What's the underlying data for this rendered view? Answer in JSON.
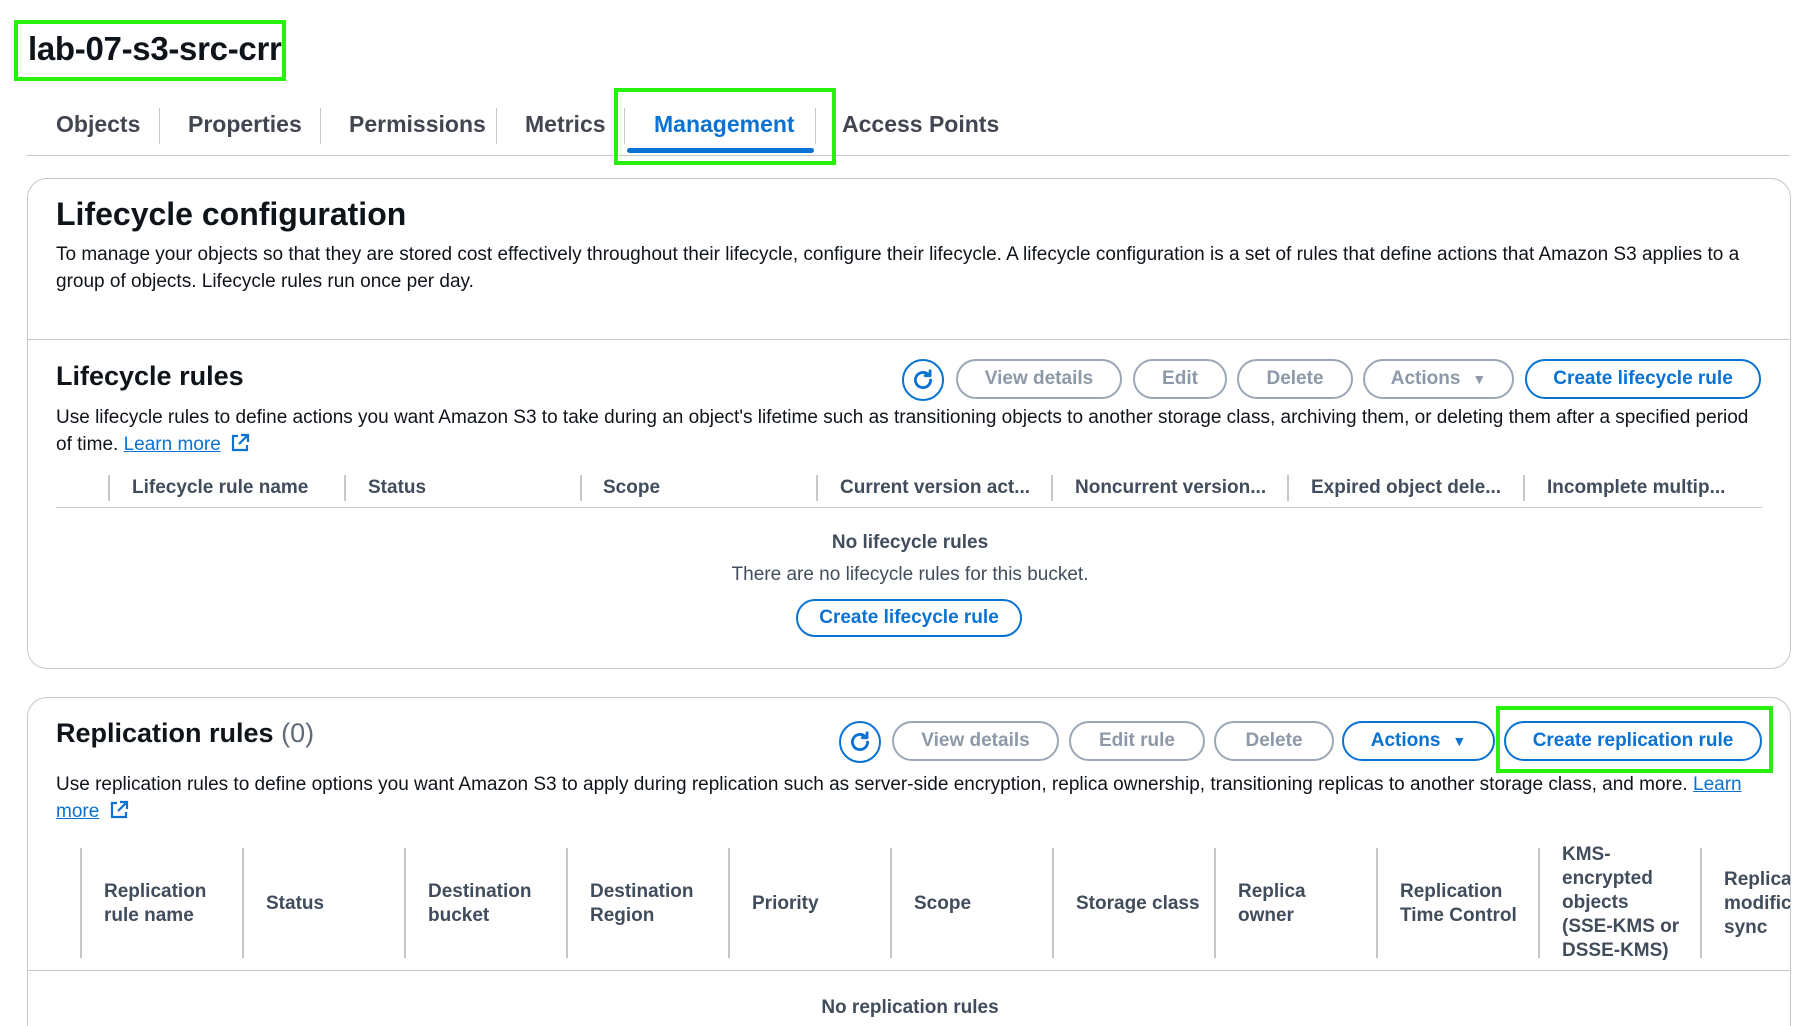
{
  "bucket": {
    "name": "lab-07-s3-src-crr"
  },
  "tabs": [
    {
      "label": "Objects"
    },
    {
      "label": "Properties"
    },
    {
      "label": "Permissions"
    },
    {
      "label": "Metrics"
    },
    {
      "label": "Management",
      "active": true
    },
    {
      "label": "Access Points"
    }
  ],
  "lifecycle": {
    "title": "Lifecycle configuration",
    "description": "To manage your objects so that they are stored cost effectively throughout their lifecycle, configure their lifecycle. A lifecycle configuration is a set of rules that define actions that Amazon S3 applies to a group of objects. Lifecycle rules run once per day.",
    "rules": {
      "title": "Lifecycle rules",
      "description": "Use lifecycle rules to define actions you want Amazon S3 to take during an object's lifetime such as transitioning objects to another storage class, archiving them, or deleting them after a specified period of time.",
      "learn_more": "Learn more",
      "buttons": {
        "view_details": "View details",
        "edit": "Edit",
        "delete": "Delete",
        "actions": "Actions",
        "create": "Create lifecycle rule"
      },
      "columns": [
        "Lifecycle rule name",
        "Status",
        "Scope",
        "Current version act...",
        "Noncurrent version...",
        "Expired object dele...",
        "Incomplete multip..."
      ],
      "empty_title": "No lifecycle rules",
      "empty_text": "There are no lifecycle rules for this bucket.",
      "empty_button": "Create lifecycle rule"
    }
  },
  "replication": {
    "title": "Replication rules",
    "count": "(0)",
    "description": "Use replication rules to define options you want Amazon S3 to apply during replication such as server-side encryption, replica ownership, transitioning replicas to another storage class, and more.",
    "learn_more": "Learn more",
    "buttons": {
      "view_details": "View details",
      "edit_rule": "Edit rule",
      "delete": "Delete",
      "actions": "Actions",
      "create": "Create replication rule"
    },
    "columns": [
      "Replication rule name",
      "Status",
      "Destination bucket",
      "Destination Region",
      "Priority",
      "Scope",
      "Storage class",
      "Replica owner",
      "Replication Time Control",
      "KMS-encrypted objects (SSE-KMS or DSSE-KMS)",
      "Replica modific sync"
    ],
    "empty_title": "No replication rules"
  },
  "colors": {
    "accent": "#0972d3",
    "highlight": "#29f10e",
    "text": "#0f141a",
    "muted": "#414d5c",
    "border": "#c6c6cd"
  }
}
